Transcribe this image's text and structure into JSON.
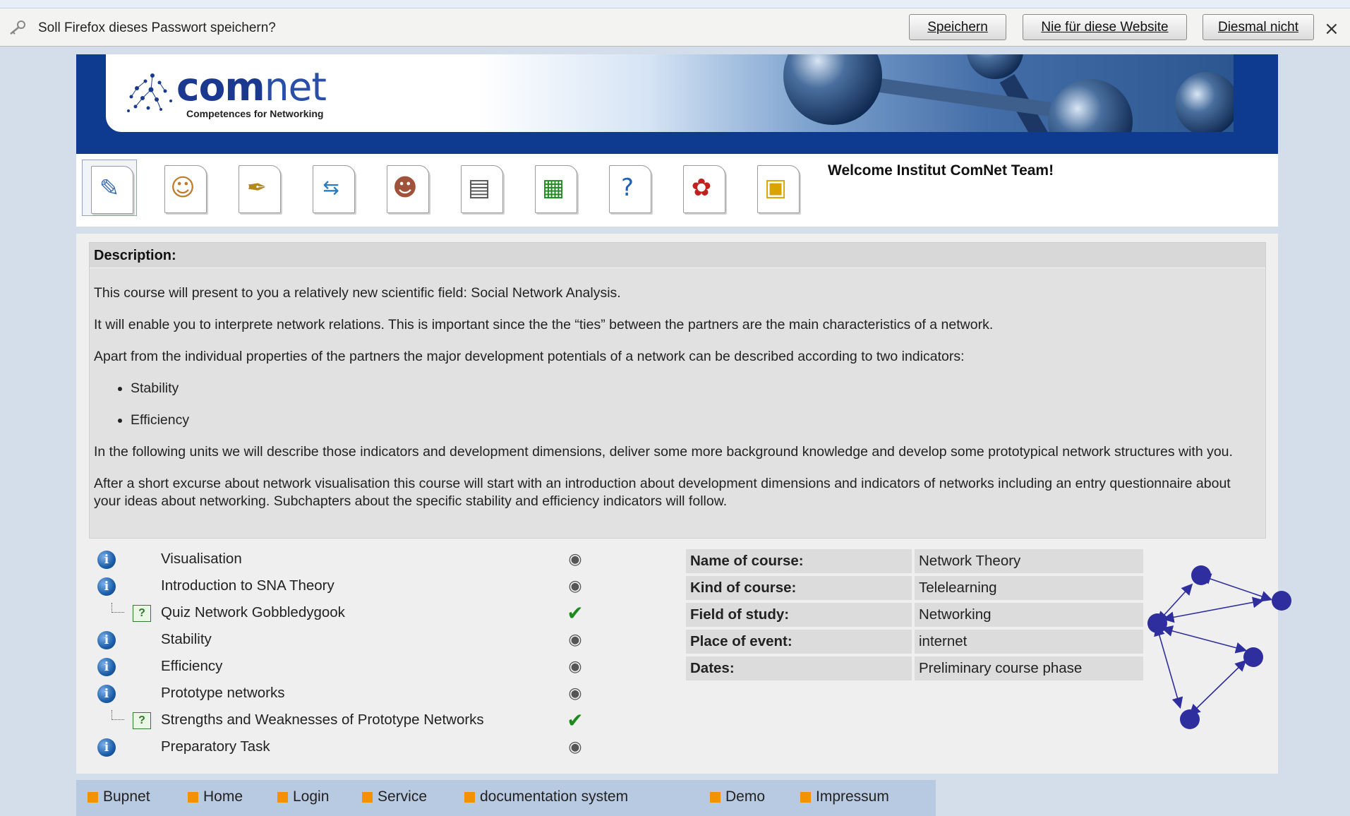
{
  "password_bar": {
    "message": "Soll Firefox dieses Passwort speichern?",
    "save_label": "Speichern",
    "never_label": "Nie für diese Website",
    "not_now_label": "Diesmal nicht",
    "close_glyph": "×"
  },
  "banner": {
    "logo_bold": "com",
    "logo_light": "net",
    "logo_subtitle": "Competences for Networking"
  },
  "toolbar": {
    "icons": [
      "edit-icon",
      "user-icon",
      "pen-icon",
      "arrows-icon",
      "group-icon",
      "archive-icon",
      "chart-icon",
      "help-icon",
      "bug-icon",
      "lock-icon"
    ],
    "welcome": "Welcome Institut ComNet Team!"
  },
  "description": {
    "heading": "Description:",
    "p1": "This course will present to you a relatively new scientific field: Social Network Analysis.",
    "p2": "It will enable you to interprete network relations. This is important since the the “ties” between the partners are the main characteristics of a network.",
    "p3": "Apart from the individual properties of the partners the major development potentials of a network can be described according to two indicators:",
    "bullets": [
      "Stability",
      "Efficiency"
    ],
    "p4": "In the following units we will describe those indicators and development dimensions, deliver some more background knowledge and develop some prototypical network structures with you.",
    "p5": "After a short excurse about network visualisation this course will start with an introduction about development dimensions and indicators of networks including an entry questionnaire about your ideas about networking. Subchapters about the specific stability and efficiency indicators will follow."
  },
  "units": [
    {
      "label": "Visualisation",
      "type": "info",
      "status": "cd"
    },
    {
      "label": "Introduction to SNA Theory",
      "type": "info",
      "status": "cd"
    },
    {
      "label": "Quiz Network Gobbledygook",
      "type": "quiz",
      "status": "done"
    },
    {
      "label": "Stability",
      "type": "info",
      "status": "cd"
    },
    {
      "label": "Efficiency",
      "type": "info",
      "status": "cd"
    },
    {
      "label": "Prototype networks",
      "type": "info",
      "status": "cd"
    },
    {
      "label": "Strengths and Weaknesses of Prototype Networks",
      "type": "quiz",
      "status": "done"
    },
    {
      "label": "Preparatory Task",
      "type": "info",
      "status": "cd"
    }
  ],
  "course_info": {
    "name_key": "Name of course:",
    "name_val": "Network Theory",
    "kind_key": "Kind of course:",
    "kind_val": "Telelearning",
    "field_key": "Field of study:",
    "field_val": "Networking",
    "place_key": "Place of event:",
    "place_val": "internet",
    "dates_key": "Dates:",
    "dates_val": "Preliminary course phase"
  },
  "footer": {
    "links": [
      "Bupnet",
      "Home",
      "Login",
      "Service",
      "documentation system",
      "Demo",
      "Impressum"
    ]
  },
  "colors": {
    "banner_blue": "#0e3b8f",
    "footer_bg": "#b8c9e2",
    "link_square": "#f39200",
    "node_blue": "#2e2e9e"
  }
}
